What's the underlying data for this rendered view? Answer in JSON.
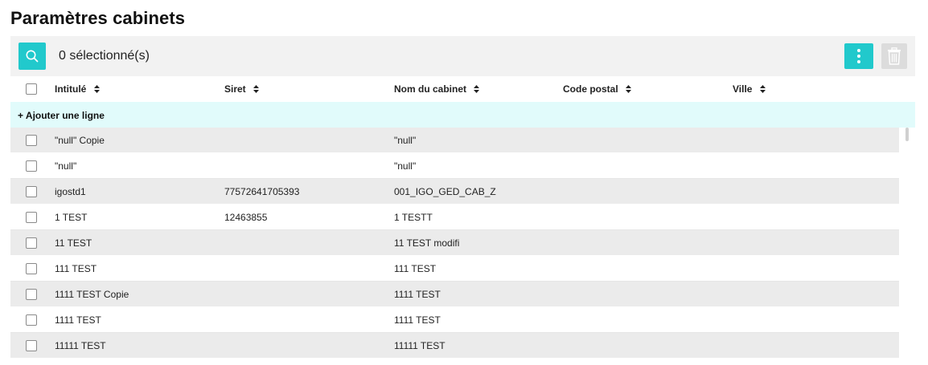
{
  "page": {
    "title": "Paramètres cabinets"
  },
  "toolbar": {
    "selection_text": "0 sélectionné(s)",
    "search_icon": "search-icon",
    "more_icon": "more-vertical-icon",
    "delete_icon": "trash-icon",
    "accent_color": "#21c9cc",
    "disabled_color": "#dcdcdc"
  },
  "table": {
    "columns": [
      "Intitulé",
      "Siret",
      "Nom du cabinet",
      "Code postal",
      "Ville"
    ],
    "add_row_label": "+ Ajouter une ligne",
    "rows": [
      {
        "intitule": "\"null\" Copie",
        "siret": "",
        "nom": "\"null\"",
        "code_postal": "",
        "ville": ""
      },
      {
        "intitule": "\"null\"",
        "siret": "",
        "nom": "\"null\"",
        "code_postal": "",
        "ville": ""
      },
      {
        "intitule": "igostd1",
        "siret": "77572641705393",
        "nom": "001_IGO_GED_CAB_Z",
        "code_postal": "",
        "ville": ""
      },
      {
        "intitule": "1 TEST",
        "siret": "12463855",
        "nom": "1 TESTT",
        "code_postal": "",
        "ville": ""
      },
      {
        "intitule": "11 TEST",
        "siret": "",
        "nom": "11 TEST modifi",
        "code_postal": "",
        "ville": ""
      },
      {
        "intitule": "111 TEST",
        "siret": "",
        "nom": "111 TEST",
        "code_postal": "",
        "ville": ""
      },
      {
        "intitule": "1111 TEST Copie",
        "siret": "",
        "nom": "1111 TEST",
        "code_postal": "",
        "ville": ""
      },
      {
        "intitule": "1111 TEST",
        "siret": "",
        "nom": "1111 TEST",
        "code_postal": "",
        "ville": ""
      },
      {
        "intitule": "11111 TEST",
        "siret": "",
        "nom": "11111 TEST",
        "code_postal": "",
        "ville": ""
      }
    ]
  }
}
